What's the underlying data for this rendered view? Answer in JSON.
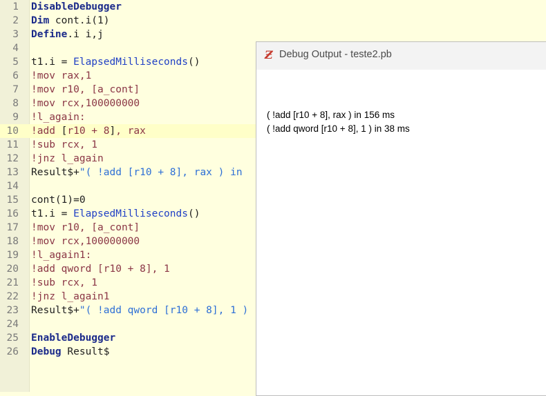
{
  "editor": {
    "lines": [
      {
        "num": "1",
        "segments": [
          {
            "t": "DisableDebugger",
            "c": "kw"
          }
        ]
      },
      {
        "num": "2",
        "segments": [
          {
            "t": "Dim",
            "c": "kw"
          },
          {
            "t": " cont.i(1)",
            "c": "plain"
          }
        ]
      },
      {
        "num": "3",
        "segments": [
          {
            "t": "Define",
            "c": "kw"
          },
          {
            "t": ".i i,j",
            "c": "plain"
          }
        ]
      },
      {
        "num": "4",
        "segments": []
      },
      {
        "num": "5",
        "segments": [
          {
            "t": "t1.i = ",
            "c": "plain"
          },
          {
            "t": "ElapsedMilliseconds",
            "c": "fn"
          },
          {
            "t": "()",
            "c": "plain"
          }
        ]
      },
      {
        "num": "6",
        "segments": [
          {
            "t": "!mov rax,1",
            "c": "asm"
          }
        ]
      },
      {
        "num": "7",
        "segments": [
          {
            "t": "!mov r10, [a_cont]",
            "c": "asm"
          }
        ]
      },
      {
        "num": "8",
        "segments": [
          {
            "t": "!mov rcx,100000000",
            "c": "asm"
          }
        ]
      },
      {
        "num": "9",
        "segments": [
          {
            "t": "!l_again:",
            "c": "asm"
          }
        ]
      },
      {
        "num": "10",
        "current": true,
        "segments": [
          {
            "t": "!add ",
            "c": "asm"
          },
          {
            "t": "[",
            "c": "plain"
          },
          {
            "t": "r10 + 8",
            "c": "asm"
          },
          {
            "t": "]",
            "c": "plain"
          },
          {
            "t": ", rax",
            "c": "asm"
          }
        ]
      },
      {
        "num": "11",
        "segments": [
          {
            "t": "!sub rcx, 1",
            "c": "asm"
          }
        ]
      },
      {
        "num": "12",
        "segments": [
          {
            "t": "!jnz l_again",
            "c": "asm"
          }
        ]
      },
      {
        "num": "13",
        "segments": [
          {
            "t": "Result$+",
            "c": "plain"
          },
          {
            "t": "\"( !add [r10 + 8], rax ) in",
            "c": "str"
          }
        ]
      },
      {
        "num": "14",
        "segments": []
      },
      {
        "num": "15",
        "segments": [
          {
            "t": "cont(1)=0",
            "c": "plain"
          }
        ]
      },
      {
        "num": "16",
        "segments": [
          {
            "t": "t1.i = ",
            "c": "plain"
          },
          {
            "t": "ElapsedMilliseconds",
            "c": "fn"
          },
          {
            "t": "()",
            "c": "plain"
          }
        ]
      },
      {
        "num": "17",
        "segments": [
          {
            "t": "!mov r10, [a_cont]",
            "c": "asm"
          }
        ]
      },
      {
        "num": "18",
        "segments": [
          {
            "t": "!mov rcx,100000000",
            "c": "asm"
          }
        ]
      },
      {
        "num": "19",
        "segments": [
          {
            "t": "!l_again1:",
            "c": "asm"
          }
        ]
      },
      {
        "num": "20",
        "segments": [
          {
            "t": "!add qword [r10 + 8], 1",
            "c": "asm"
          }
        ]
      },
      {
        "num": "21",
        "segments": [
          {
            "t": "!sub rcx, 1",
            "c": "asm"
          }
        ]
      },
      {
        "num": "22",
        "segments": [
          {
            "t": "!jnz l_again1",
            "c": "asm"
          }
        ]
      },
      {
        "num": "23",
        "segments": [
          {
            "t": "Result$+",
            "c": "plain"
          },
          {
            "t": "\"( !add qword [r10 + 8], 1 )",
            "c": "str"
          }
        ]
      },
      {
        "num": "24",
        "segments": []
      },
      {
        "num": "25",
        "segments": [
          {
            "t": "EnableDebugger",
            "c": "kw"
          }
        ]
      },
      {
        "num": "26",
        "segments": [
          {
            "t": "Debug",
            "c": "kw"
          },
          {
            "t": " Result$",
            "c": "plain"
          }
        ]
      }
    ]
  },
  "debug_window": {
    "icon": "purebasic-logo-icon",
    "icon_glyph": "Ƶ",
    "title": "Debug Output - teste2.pb",
    "output": [
      "( !add [r10 + 8], rax ) in 156 ms",
      "( !add qword [r10 + 8], 1 ) in 38 ms"
    ]
  }
}
